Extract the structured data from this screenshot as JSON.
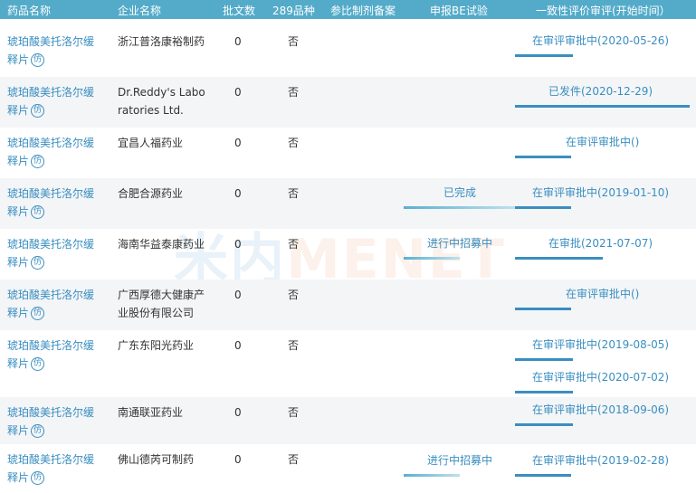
{
  "columns": {
    "drug": "药品名称",
    "company": "企业名称",
    "batch": "批文数",
    "v289": "289品种",
    "ref": "参比制剂备案",
    "be": "申报BE试验",
    "consistency": "一致性评价审评(开始时间）"
  },
  "fang_label": "仿",
  "watermark": {
    "cn": "米内",
    "en": "MENET"
  },
  "rows": [
    {
      "drug1": "琥珀酸美托洛尔缓",
      "drug2": "释片",
      "company": [
        "浙江普洛康裕制药"
      ],
      "batch": "0",
      "v289": "否",
      "be": "",
      "cons": [
        "在审评审批中(2020-05-26)"
      ]
    },
    {
      "drug1": "琥珀酸美托洛尔缓",
      "drug2": "释片",
      "company": [
        "Dr.Reddy's Labo",
        "ratories Ltd."
      ],
      "batch": "0",
      "v289": "否",
      "be": "",
      "cons": [
        "已发件(2020-12-29)"
      ]
    },
    {
      "drug1": "琥珀酸美托洛尔缓",
      "drug2": "释片",
      "company": [
        "宜昌人福药业"
      ],
      "batch": "0",
      "v289": "否",
      "be": "",
      "cons": [
        "在审评审批中()"
      ]
    },
    {
      "drug1": "琥珀酸美托洛尔缓",
      "drug2": "释片",
      "company": [
        "合肥合源药业"
      ],
      "batch": "0",
      "v289": "否",
      "be": "已完成",
      "cons": [
        "在审评审批中(2019-01-10)"
      ]
    },
    {
      "drug1": "琥珀酸美托洛尔缓",
      "drug2": "释片",
      "company": [
        "海南华益泰康药业"
      ],
      "batch": "0",
      "v289": "否",
      "be": "进行中招募中",
      "cons": [
        "在审批(2021-07-07)"
      ]
    },
    {
      "drug1": "琥珀酸美托洛尔缓",
      "drug2": "释片",
      "company": [
        "广西厚德大健康产",
        "业股份有限公司"
      ],
      "batch": "0",
      "v289": "否",
      "be": "",
      "cons": [
        "在审评审批中()"
      ]
    },
    {
      "drug1": "琥珀酸美托洛尔缓",
      "drug2": "释片",
      "company": [
        "广东东阳光药业"
      ],
      "batch": "0",
      "v289": "否",
      "be": "",
      "cons": [
        "在审评审批中(2019-08-05)",
        "在审评审批中(2020-07-02)"
      ]
    },
    {
      "drug1": "琥珀酸美托洛尔缓",
      "drug2": "释片",
      "company": [
        "南通联亚药业"
      ],
      "batch": "0",
      "v289": "否",
      "be": "",
      "cons": [
        "在审评审批中(2018-09-06)"
      ]
    },
    {
      "drug1": "琥珀酸美托洛尔缓",
      "drug2": "释片",
      "company": [
        "佛山德芮可制药"
      ],
      "batch": "0",
      "v289": "否",
      "be": "进行中招募中",
      "cons": [
        "在审评审批中(2019-02-28)"
      ]
    }
  ]
}
